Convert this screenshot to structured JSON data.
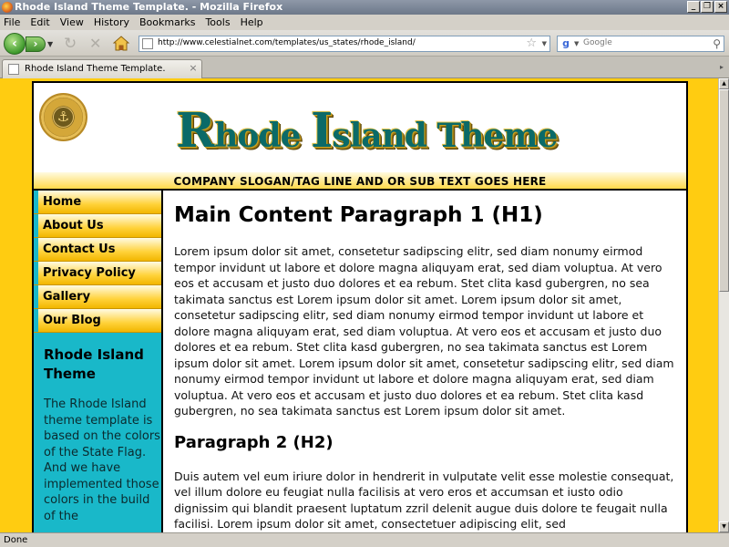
{
  "window": {
    "title": "Rhode Island Theme Template. - Mozilla Firefox",
    "controls": [
      "_",
      "❐",
      "×"
    ]
  },
  "menu": [
    "File",
    "Edit",
    "View",
    "History",
    "Bookmarks",
    "Tools",
    "Help"
  ],
  "toolbar": {
    "url": "http://www.celestialnet.com/templates/us_states/rhode_island/",
    "search_placeholder": "Google",
    "search_engine_icon": "g"
  },
  "tabs": [
    {
      "label": "Rhode Island Theme Template."
    }
  ],
  "page": {
    "logo_first_big": "R",
    "logo_first_rest": "hode ",
    "logo_second_big": "I",
    "logo_second_rest": "sland ",
    "logo_third": "Theme",
    "slogan": "COMPANY SLOGAN/TAG LINE AND OR SUB TEXT GOES HERE",
    "nav": [
      "Home",
      "About Us",
      "Contact Us",
      "Privacy Policy",
      "Gallery",
      "Our Blog"
    ],
    "sidebar_title": "Rhode Island Theme",
    "sidebar_body": "The Rhode Island theme template is based on the colors of the State Flag. And we have implemented those colors in the build of the",
    "h1": "Main Content Paragraph 1 (H1)",
    "p1": "Lorem ipsum dolor sit amet, consetetur sadipscing elitr, sed diam nonumy eirmod tempor invidunt ut labore et dolore magna aliquyam erat, sed diam voluptua. At vero eos et accusam et justo duo dolores et ea rebum. Stet clita kasd gubergren, no sea takimata sanctus est Lorem ipsum dolor sit amet. Lorem ipsum dolor sit amet, consetetur sadipscing elitr, sed diam nonumy eirmod tempor invidunt ut labore et dolore magna aliquyam erat, sed diam voluptua. At vero eos et accusam et justo duo dolores et ea rebum. Stet clita kasd gubergren, no sea takimata sanctus est Lorem ipsum dolor sit amet. Lorem ipsum dolor sit amet, consetetur sadipscing elitr, sed diam nonumy eirmod tempor invidunt ut labore et dolore magna aliquyam erat, sed diam voluptua. At vero eos et accusam et justo duo dolores et ea rebum. Stet clita kasd gubergren, no sea takimata sanctus est Lorem ipsum dolor sit amet.",
    "h2": "Paragraph 2 (H2)",
    "p2": "Duis autem vel eum iriure dolor in hendrerit in vulputate velit esse molestie consequat, vel illum dolore eu feugiat nulla facilisis at vero eros et accumsan et iusto odio dignissim qui blandit praesent luptatum zzril delenit augue duis dolore te feugait nulla facilisi. Lorem ipsum dolor sit amet, consectetuer adipiscing elit, sed"
  },
  "status": "Done",
  "colors": {
    "page_background": "#ffcc11",
    "sidebar_background": "#19b8c9",
    "logo_text": "#0b6a68"
  }
}
